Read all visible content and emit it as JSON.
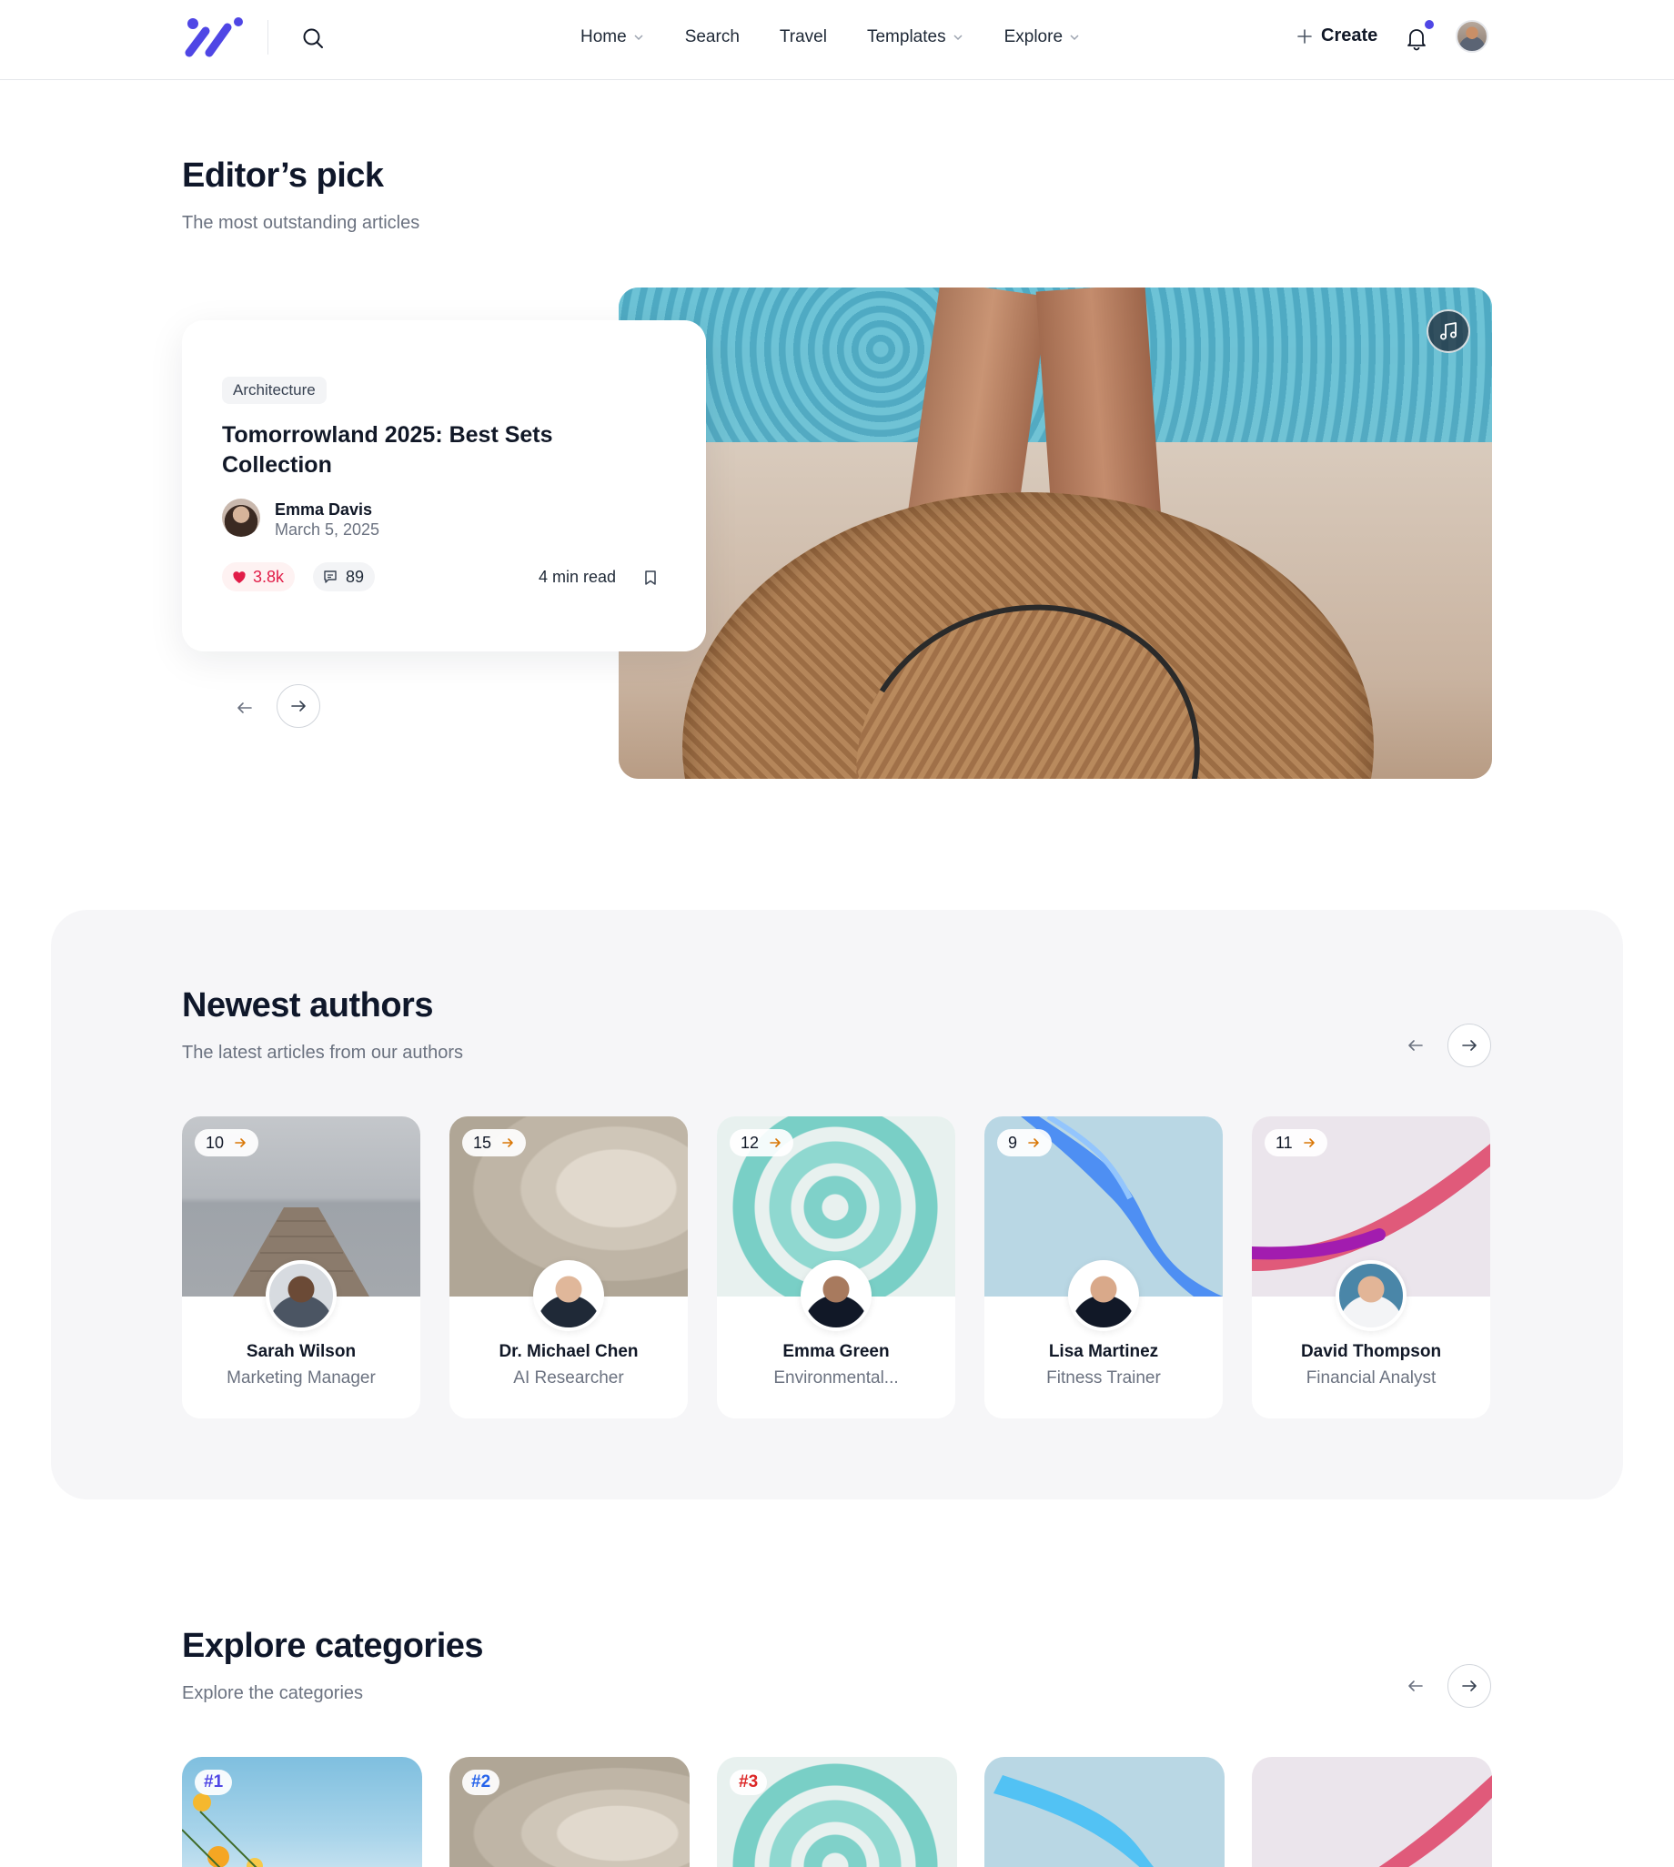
{
  "header": {
    "nav": [
      {
        "label": "Home",
        "has_dropdown": true
      },
      {
        "label": "Search",
        "has_dropdown": false
      },
      {
        "label": "Travel",
        "has_dropdown": false
      },
      {
        "label": "Templates",
        "has_dropdown": true
      },
      {
        "label": "Explore",
        "has_dropdown": true
      }
    ],
    "create_label": "Create",
    "has_notification": true,
    "accent_color": "#4f46e5"
  },
  "editors_pick": {
    "title": "Editor’s pick",
    "subtitle": "The most outstanding articles",
    "article": {
      "category": "Architecture",
      "title": "Tomorrowland 2025: Best Sets Collection",
      "author": "Emma Davis",
      "date": "March 5, 2025",
      "likes": "3.8k",
      "comments": "89",
      "read_time": "4 min read"
    },
    "media_icon": "music-icon"
  },
  "newest_authors": {
    "title": "Newest authors",
    "subtitle": "The latest articles from our authors",
    "authors": [
      {
        "name": "Sarah Wilson",
        "role": "Marketing Manager",
        "count": "10"
      },
      {
        "name": "Dr. Michael Chen",
        "role": "AI Researcher",
        "count": "15"
      },
      {
        "name": "Emma Green",
        "role": "Environmental...",
        "count": "12"
      },
      {
        "name": "Lisa Martinez",
        "role": "Fitness Trainer",
        "count": "9"
      },
      {
        "name": "David Thompson",
        "role": "Financial Analyst",
        "count": "11"
      }
    ]
  },
  "explore_categories": {
    "title": "Explore categories",
    "subtitle": "Explore the categories",
    "categories": [
      {
        "rank": "#1",
        "rank_color": "#4f46e5"
      },
      {
        "rank": "#2",
        "rank_color": "#2563eb"
      },
      {
        "rank": "#3",
        "rank_color": "#dc2626"
      },
      {
        "rank": "",
        "rank_color": ""
      },
      {
        "rank": "",
        "rank_color": ""
      }
    ]
  }
}
